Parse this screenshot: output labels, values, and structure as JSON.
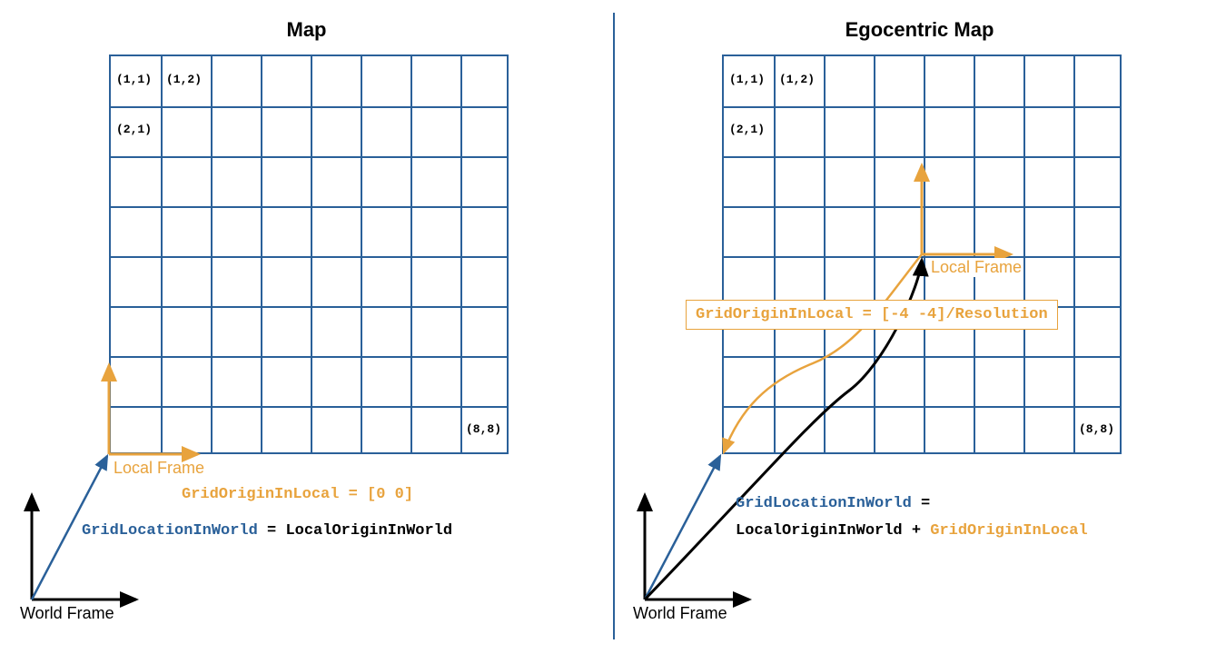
{
  "left": {
    "title": "Map",
    "world_frame_label": "World Frame",
    "local_frame_label": "Local Frame",
    "cell_11": "(1,1)",
    "cell_12": "(1,2)",
    "cell_21": "(2,1)",
    "cell_88": "(8,8)",
    "grid_origin_formula": "GridOriginInLocal = [0 0]",
    "grid_loc_label": "GridLocationInWorld",
    "equals": " = ",
    "local_origin_label": "LocalOriginInWorld"
  },
  "right": {
    "title": "Egocentric Map",
    "world_frame_label": "World Frame",
    "local_frame_label": "Local Frame",
    "cell_11": "(1,1)",
    "cell_12": "(1,2)",
    "cell_21": "(2,1)",
    "cell_88": "(8,8)",
    "grid_origin_formula": "GridOriginInLocal = [-4 -4]/Resolution",
    "grid_loc_label": "GridLocationInWorld",
    "equals2": " =",
    "local_origin_label": "LocalOriginInWorld",
    "plus": " + ",
    "grid_origin_label": "GridOriginInLocal"
  },
  "colors": {
    "grid": "#2A6099",
    "orange": "#E8A33D",
    "black": "#000000"
  }
}
